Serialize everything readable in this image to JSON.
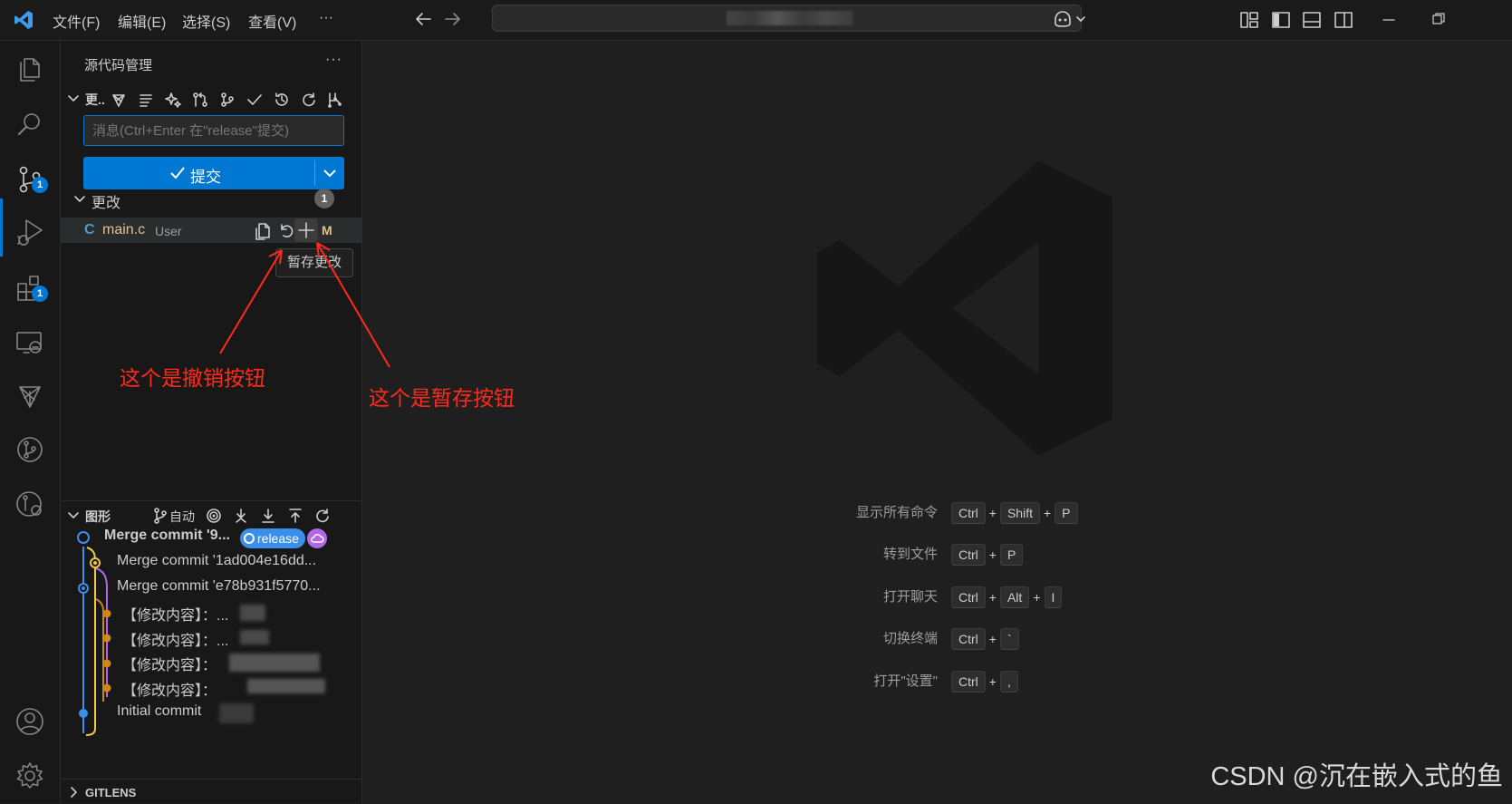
{
  "menu": {
    "file": "文件(F)",
    "edit": "编辑(E)",
    "selection": "选择(S)",
    "view": "查看(V)",
    "more": "···"
  },
  "colors": {
    "accent": "#0078d4",
    "modified": "#e2c08d",
    "annotation": "#ff2a1a",
    "graph_blue": "#3b8eea",
    "graph_yellow": "#f2c744",
    "graph_orange": "#d18616",
    "graph_purple": "#b267e6"
  },
  "activity_badges": {
    "source_control": "1",
    "extensions": "1"
  },
  "scm": {
    "title": "源代码管理",
    "more": "···",
    "changes_section_short": "更..",
    "message_placeholder": "消息(Ctrl+Enter 在\"release\"提交)",
    "commit_label": "提交",
    "changes_label": "更改",
    "changes_count": "1",
    "file": {
      "lang_letter": "C",
      "name": "main.c",
      "path": "User",
      "status": "M"
    },
    "tooltip": "暂存更改"
  },
  "graph": {
    "title": "图形",
    "auto_label": "自动",
    "branch_badge": "release",
    "commits": [
      "Merge commit '9...",
      "Merge commit '1ad004e16dd...",
      "Merge commit 'e78b931f5770...",
      "【修改内容】：...",
      "【修改内容】：...",
      "【修改内容】：",
      "【修改内容】：",
      "Initial commit"
    ]
  },
  "gitlens_label": "GITLENS",
  "shortcuts": [
    {
      "label": "显示所有命令",
      "keys": [
        "Ctrl",
        "Shift",
        "P"
      ]
    },
    {
      "label": "转到文件",
      "keys": [
        "Ctrl",
        "P"
      ]
    },
    {
      "label": "打开聊天",
      "keys": [
        "Ctrl",
        "Alt",
        "I"
      ]
    },
    {
      "label": "切换终端",
      "keys": [
        "Ctrl",
        "`"
      ]
    },
    {
      "label": "打开\"设置\"",
      "keys": [
        "Ctrl",
        ","
      ]
    }
  ],
  "annotations": {
    "undo": "这个是撤销按钮",
    "stage": "这个是暂存按钮"
  },
  "watermark": "CSDN @沉在嵌入式的鱼"
}
